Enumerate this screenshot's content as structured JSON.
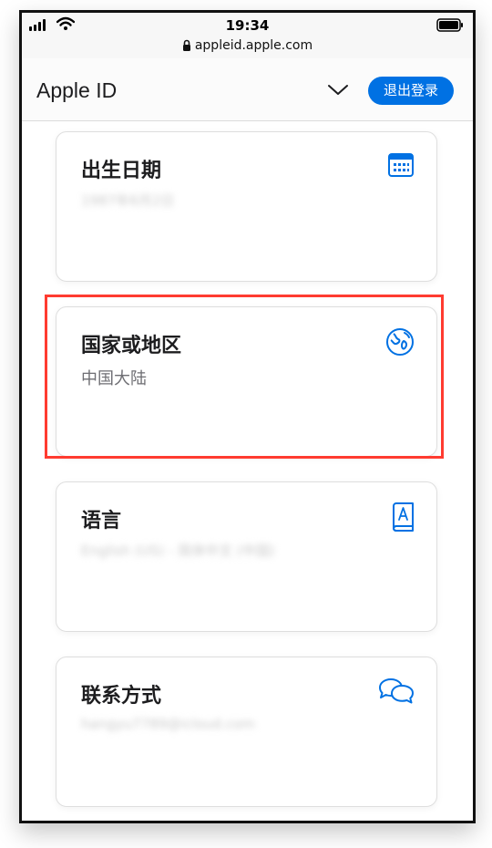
{
  "status_bar": {
    "time": "19:34"
  },
  "browser": {
    "url": "appleid.apple.com"
  },
  "header": {
    "title": "Apple ID",
    "signout_label": "退出登录"
  },
  "cards": [
    {
      "title": "出生日期",
      "value": "1987年6月2日",
      "icon": "calendar-icon"
    },
    {
      "title": "国家或地区",
      "value": "中国大陆",
      "icon": "globe-icon"
    },
    {
      "title": "语言",
      "value": "English (US) - 简体中文 (中国)",
      "icon": "book-icon"
    },
    {
      "title": "联系方式",
      "value": "hangyu7789@icloud.com",
      "icon": "chat-bubbles-icon"
    }
  ],
  "colors": {
    "accent": "#0071e3",
    "highlight": "#ff3b30"
  }
}
